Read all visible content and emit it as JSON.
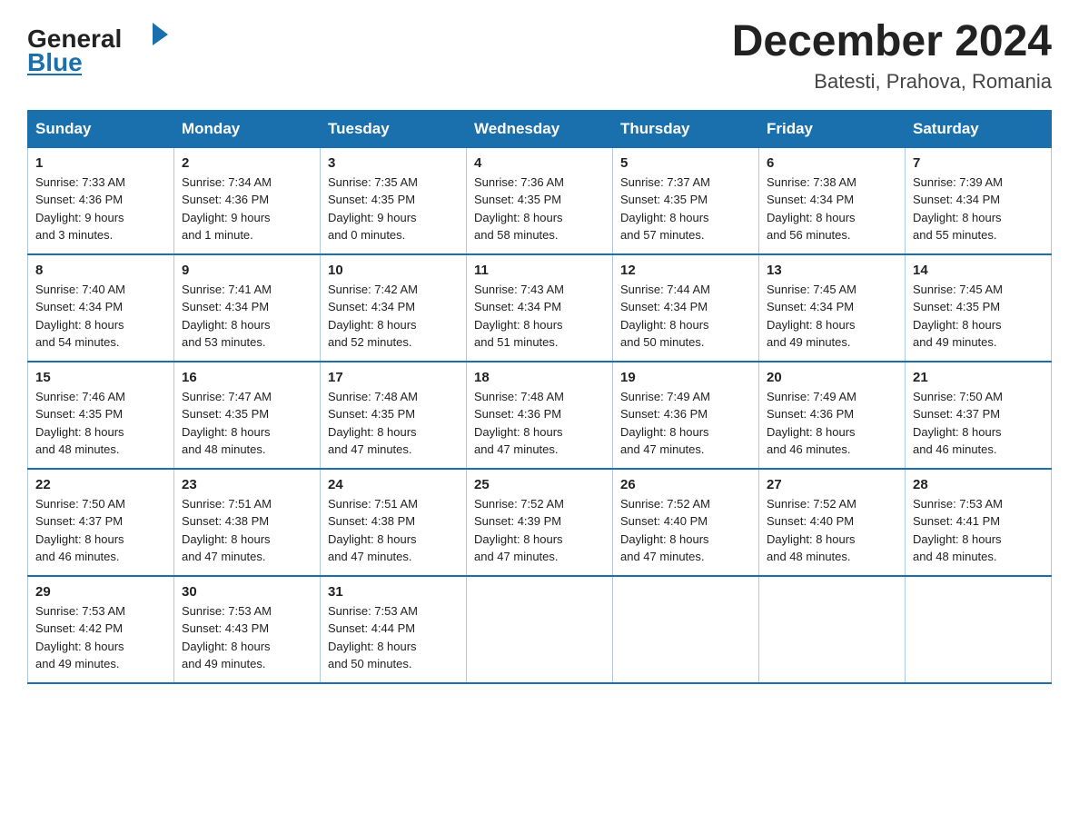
{
  "header": {
    "logo_general": "General",
    "logo_blue": "Blue",
    "month_year": "December 2024",
    "location": "Batesti, Prahova, Romania"
  },
  "days_of_week": [
    "Sunday",
    "Monday",
    "Tuesday",
    "Wednesday",
    "Thursday",
    "Friday",
    "Saturday"
  ],
  "weeks": [
    [
      {
        "day": "1",
        "sunrise": "7:33 AM",
        "sunset": "4:36 PM",
        "daylight": "9 hours and 3 minutes."
      },
      {
        "day": "2",
        "sunrise": "7:34 AM",
        "sunset": "4:36 PM",
        "daylight": "9 hours and 1 minute."
      },
      {
        "day": "3",
        "sunrise": "7:35 AM",
        "sunset": "4:35 PM",
        "daylight": "9 hours and 0 minutes."
      },
      {
        "day": "4",
        "sunrise": "7:36 AM",
        "sunset": "4:35 PM",
        "daylight": "8 hours and 58 minutes."
      },
      {
        "day": "5",
        "sunrise": "7:37 AM",
        "sunset": "4:35 PM",
        "daylight": "8 hours and 57 minutes."
      },
      {
        "day": "6",
        "sunrise": "7:38 AM",
        "sunset": "4:34 PM",
        "daylight": "8 hours and 56 minutes."
      },
      {
        "day": "7",
        "sunrise": "7:39 AM",
        "sunset": "4:34 PM",
        "daylight": "8 hours and 55 minutes."
      }
    ],
    [
      {
        "day": "8",
        "sunrise": "7:40 AM",
        "sunset": "4:34 PM",
        "daylight": "8 hours and 54 minutes."
      },
      {
        "day": "9",
        "sunrise": "7:41 AM",
        "sunset": "4:34 PM",
        "daylight": "8 hours and 53 minutes."
      },
      {
        "day": "10",
        "sunrise": "7:42 AM",
        "sunset": "4:34 PM",
        "daylight": "8 hours and 52 minutes."
      },
      {
        "day": "11",
        "sunrise": "7:43 AM",
        "sunset": "4:34 PM",
        "daylight": "8 hours and 51 minutes."
      },
      {
        "day": "12",
        "sunrise": "7:44 AM",
        "sunset": "4:34 PM",
        "daylight": "8 hours and 50 minutes."
      },
      {
        "day": "13",
        "sunrise": "7:45 AM",
        "sunset": "4:34 PM",
        "daylight": "8 hours and 49 minutes."
      },
      {
        "day": "14",
        "sunrise": "7:45 AM",
        "sunset": "4:35 PM",
        "daylight": "8 hours and 49 minutes."
      }
    ],
    [
      {
        "day": "15",
        "sunrise": "7:46 AM",
        "sunset": "4:35 PM",
        "daylight": "8 hours and 48 minutes."
      },
      {
        "day": "16",
        "sunrise": "7:47 AM",
        "sunset": "4:35 PM",
        "daylight": "8 hours and 48 minutes."
      },
      {
        "day": "17",
        "sunrise": "7:48 AM",
        "sunset": "4:35 PM",
        "daylight": "8 hours and 47 minutes."
      },
      {
        "day": "18",
        "sunrise": "7:48 AM",
        "sunset": "4:36 PM",
        "daylight": "8 hours and 47 minutes."
      },
      {
        "day": "19",
        "sunrise": "7:49 AM",
        "sunset": "4:36 PM",
        "daylight": "8 hours and 47 minutes."
      },
      {
        "day": "20",
        "sunrise": "7:49 AM",
        "sunset": "4:36 PM",
        "daylight": "8 hours and 46 minutes."
      },
      {
        "day": "21",
        "sunrise": "7:50 AM",
        "sunset": "4:37 PM",
        "daylight": "8 hours and 46 minutes."
      }
    ],
    [
      {
        "day": "22",
        "sunrise": "7:50 AM",
        "sunset": "4:37 PM",
        "daylight": "8 hours and 46 minutes."
      },
      {
        "day": "23",
        "sunrise": "7:51 AM",
        "sunset": "4:38 PM",
        "daylight": "8 hours and 47 minutes."
      },
      {
        "day": "24",
        "sunrise": "7:51 AM",
        "sunset": "4:38 PM",
        "daylight": "8 hours and 47 minutes."
      },
      {
        "day": "25",
        "sunrise": "7:52 AM",
        "sunset": "4:39 PM",
        "daylight": "8 hours and 47 minutes."
      },
      {
        "day": "26",
        "sunrise": "7:52 AM",
        "sunset": "4:40 PM",
        "daylight": "8 hours and 47 minutes."
      },
      {
        "day": "27",
        "sunrise": "7:52 AM",
        "sunset": "4:40 PM",
        "daylight": "8 hours and 48 minutes."
      },
      {
        "day": "28",
        "sunrise": "7:53 AM",
        "sunset": "4:41 PM",
        "daylight": "8 hours and 48 minutes."
      }
    ],
    [
      {
        "day": "29",
        "sunrise": "7:53 AM",
        "sunset": "4:42 PM",
        "daylight": "8 hours and 49 minutes."
      },
      {
        "day": "30",
        "sunrise": "7:53 AM",
        "sunset": "4:43 PM",
        "daylight": "8 hours and 49 minutes."
      },
      {
        "day": "31",
        "sunrise": "7:53 AM",
        "sunset": "4:44 PM",
        "daylight": "8 hours and 50 minutes."
      },
      null,
      null,
      null,
      null
    ]
  ],
  "labels": {
    "sunrise": "Sunrise:",
    "sunset": "Sunset:",
    "daylight": "Daylight:"
  }
}
